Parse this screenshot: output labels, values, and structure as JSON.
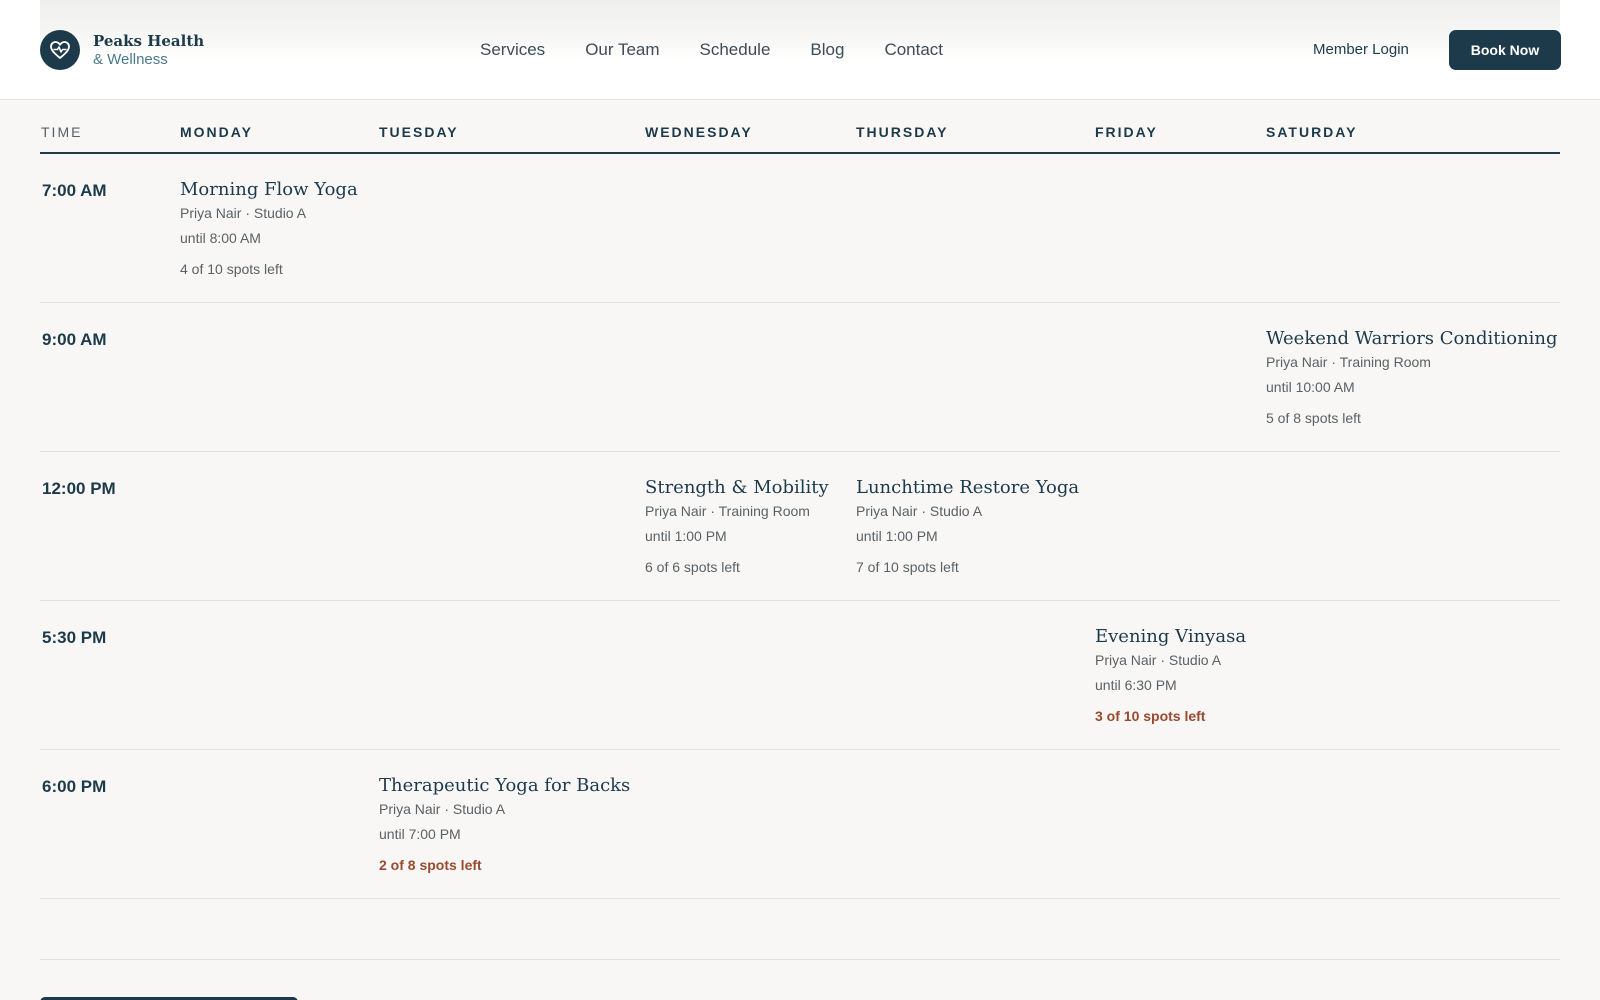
{
  "brand": {
    "name": "Peaks Health",
    "sub": "& Wellness",
    "logo_icon": "heart-pulse-icon",
    "colors": {
      "primary": "#1d3a4a",
      "accent": "#4a7a8a",
      "low_spots": "#9a4a2e"
    }
  },
  "nav": [
    "Services",
    "Our Team",
    "Schedule",
    "Blog",
    "Contact"
  ],
  "header": {
    "member_login": "Member Login",
    "book_now": "Book Now"
  },
  "schedule": {
    "columns": [
      "TIME",
      "MONDAY",
      "TUESDAY",
      "WEDNESDAY",
      "THURSDAY",
      "FRIDAY",
      "SATURDAY"
    ],
    "rows": [
      {
        "time": "7:00 AM",
        "classes": [
          {
            "day": "MONDAY",
            "name": "Morning Flow Yoga",
            "meta": "Priya Nair · Studio A",
            "until": "until 8:00 AM",
            "spots": "4 of 10 spots left",
            "low": false
          }
        ]
      },
      {
        "time": "9:00 AM",
        "classes": [
          {
            "day": "SATURDAY",
            "name": "Weekend Warriors Conditioning",
            "meta": "Priya Nair · Training Room",
            "until": "until 10:00 AM",
            "spots": "5 of 8 spots left",
            "low": false
          }
        ]
      },
      {
        "time": "12:00 PM",
        "classes": [
          {
            "day": "WEDNESDAY",
            "name": "Strength & Mobility",
            "meta": "Priya Nair · Training Room",
            "until": "until 1:00 PM",
            "spots": "6 of 6 spots left",
            "low": false
          },
          {
            "day": "THURSDAY",
            "name": "Lunchtime Restore Yoga",
            "meta": "Priya Nair · Studio A",
            "until": "until 1:00 PM",
            "spots": "7 of 10 spots left",
            "low": false
          }
        ]
      },
      {
        "time": "5:30 PM",
        "classes": [
          {
            "day": "FRIDAY",
            "name": "Evening Vinyasa",
            "meta": "Priya Nair · Studio A",
            "until": "until 6:30 PM",
            "spots": "3 of 10 spots left",
            "low": true
          }
        ]
      },
      {
        "time": "6:00 PM",
        "classes": [
          {
            "day": "TUESDAY",
            "name": "Therapeutic Yoga for Backs",
            "meta": "Priya Nair · Studio A",
            "until": "until 7:00 PM",
            "spots": "2 of 8 spots left",
            "low": true
          }
        ]
      }
    ]
  }
}
